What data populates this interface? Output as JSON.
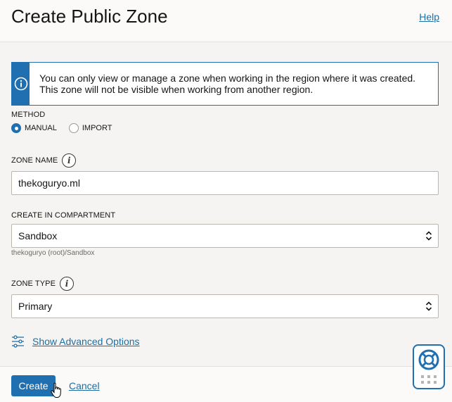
{
  "header": {
    "title": "Create Public Zone",
    "help_label": "Help"
  },
  "info_banner": {
    "icon": "info-icon",
    "message": "You can only view or manage a zone when working in the region where it was created. This zone will not be visible when working from another region."
  },
  "method": {
    "label": "METHOD",
    "options": [
      {
        "label": "MANUAL",
        "selected": true
      },
      {
        "label": "IMPORT",
        "selected": false
      }
    ]
  },
  "zone_name": {
    "label": "ZONE NAME",
    "value": "thekoguryo.ml"
  },
  "compartment": {
    "label": "CREATE IN COMPARTMENT",
    "value": "Sandbox",
    "path": "thekoguryo (root)/Sandbox"
  },
  "zone_type": {
    "label": "ZONE TYPE",
    "value": "Primary"
  },
  "advanced": {
    "icon": "sliders-icon",
    "label": "Show Advanced Options"
  },
  "footer": {
    "create_label": "Create",
    "cancel_label": "Cancel"
  },
  "help_widget": {
    "icon": "lifebuoy-icon"
  },
  "colors": {
    "accent": "#1f6fb1",
    "link": "#1c6ea5",
    "background": "#f5f4f2"
  }
}
